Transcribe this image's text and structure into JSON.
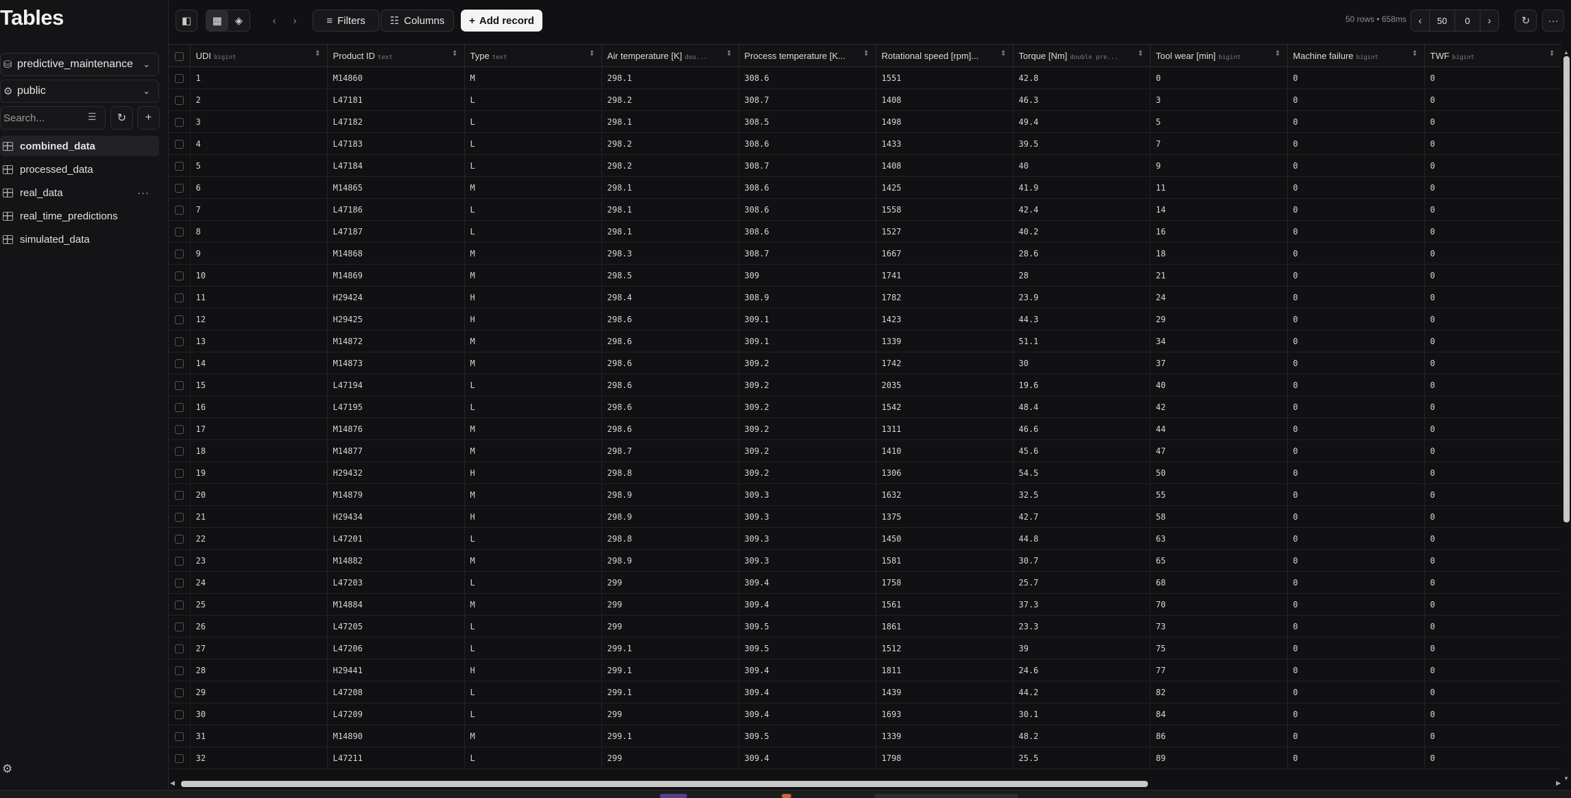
{
  "sidebar": {
    "title": "Tables",
    "database": "predictive_maintenance",
    "schema": "public",
    "search_placeholder": "Search...",
    "tables": [
      {
        "name": "combined_data"
      },
      {
        "name": "processed_data"
      },
      {
        "name": "real_data"
      },
      {
        "name": "real_time_predictions"
      },
      {
        "name": "simulated_data"
      }
    ],
    "more_glyph": "···",
    "settings_icon": "gear-icon"
  },
  "toolbar": {
    "filters_label": "Filters",
    "columns_label": "Columns",
    "add_record_label": "Add record",
    "stats": "50 rows • 658ms",
    "page_size": "50",
    "page_offset": "0"
  },
  "columns": [
    {
      "name": "UDI",
      "type": "bigint"
    },
    {
      "name": "Product ID",
      "type": "text"
    },
    {
      "name": "Type",
      "type": "text"
    },
    {
      "name": "Air temperature [K]",
      "type": "dou..."
    },
    {
      "name": "Process temperature [K...",
      "type": ""
    },
    {
      "name": "Rotational speed [rpm]...",
      "type": ""
    },
    {
      "name": "Torque [Nm]",
      "type": "double pre..."
    },
    {
      "name": "Tool wear [min]",
      "type": "bigint"
    },
    {
      "name": "Machine failure",
      "type": "bigint"
    },
    {
      "name": "TWF",
      "type": "bigint"
    }
  ],
  "rows": [
    [
      "1",
      "M14860",
      "M",
      "298.1",
      "308.6",
      "1551",
      "42.8",
      "0",
      "0",
      "0"
    ],
    [
      "2",
      "L47181",
      "L",
      "298.2",
      "308.7",
      "1408",
      "46.3",
      "3",
      "0",
      "0"
    ],
    [
      "3",
      "L47182",
      "L",
      "298.1",
      "308.5",
      "1498",
      "49.4",
      "5",
      "0",
      "0"
    ],
    [
      "4",
      "L47183",
      "L",
      "298.2",
      "308.6",
      "1433",
      "39.5",
      "7",
      "0",
      "0"
    ],
    [
      "5",
      "L47184",
      "L",
      "298.2",
      "308.7",
      "1408",
      "40",
      "9",
      "0",
      "0"
    ],
    [
      "6",
      "M14865",
      "M",
      "298.1",
      "308.6",
      "1425",
      "41.9",
      "11",
      "0",
      "0"
    ],
    [
      "7",
      "L47186",
      "L",
      "298.1",
      "308.6",
      "1558",
      "42.4",
      "14",
      "0",
      "0"
    ],
    [
      "8",
      "L47187",
      "L",
      "298.1",
      "308.6",
      "1527",
      "40.2",
      "16",
      "0",
      "0"
    ],
    [
      "9",
      "M14868",
      "M",
      "298.3",
      "308.7",
      "1667",
      "28.6",
      "18",
      "0",
      "0"
    ],
    [
      "10",
      "M14869",
      "M",
      "298.5",
      "309",
      "1741",
      "28",
      "21",
      "0",
      "0"
    ],
    [
      "11",
      "H29424",
      "H",
      "298.4",
      "308.9",
      "1782",
      "23.9",
      "24",
      "0",
      "0"
    ],
    [
      "12",
      "H29425",
      "H",
      "298.6",
      "309.1",
      "1423",
      "44.3",
      "29",
      "0",
      "0"
    ],
    [
      "13",
      "M14872",
      "M",
      "298.6",
      "309.1",
      "1339",
      "51.1",
      "34",
      "0",
      "0"
    ],
    [
      "14",
      "M14873",
      "M",
      "298.6",
      "309.2",
      "1742",
      "30",
      "37",
      "0",
      "0"
    ],
    [
      "15",
      "L47194",
      "L",
      "298.6",
      "309.2",
      "2035",
      "19.6",
      "40",
      "0",
      "0"
    ],
    [
      "16",
      "L47195",
      "L",
      "298.6",
      "309.2",
      "1542",
      "48.4",
      "42",
      "0",
      "0"
    ],
    [
      "17",
      "M14876",
      "M",
      "298.6",
      "309.2",
      "1311",
      "46.6",
      "44",
      "0",
      "0"
    ],
    [
      "18",
      "M14877",
      "M",
      "298.7",
      "309.2",
      "1410",
      "45.6",
      "47",
      "0",
      "0"
    ],
    [
      "19",
      "H29432",
      "H",
      "298.8",
      "309.2",
      "1306",
      "54.5",
      "50",
      "0",
      "0"
    ],
    [
      "20",
      "M14879",
      "M",
      "298.9",
      "309.3",
      "1632",
      "32.5",
      "55",
      "0",
      "0"
    ],
    [
      "21",
      "H29434",
      "H",
      "298.9",
      "309.3",
      "1375",
      "42.7",
      "58",
      "0",
      "0"
    ],
    [
      "22",
      "L47201",
      "L",
      "298.8",
      "309.3",
      "1450",
      "44.8",
      "63",
      "0",
      "0"
    ],
    [
      "23",
      "M14882",
      "M",
      "298.9",
      "309.3",
      "1581",
      "30.7",
      "65",
      "0",
      "0"
    ],
    [
      "24",
      "L47203",
      "L",
      "299",
      "309.4",
      "1758",
      "25.7",
      "68",
      "0",
      "0"
    ],
    [
      "25",
      "M14884",
      "M",
      "299",
      "309.4",
      "1561",
      "37.3",
      "70",
      "0",
      "0"
    ],
    [
      "26",
      "L47205",
      "L",
      "299",
      "309.5",
      "1861",
      "23.3",
      "73",
      "0",
      "0"
    ],
    [
      "27",
      "L47206",
      "L",
      "299.1",
      "309.5",
      "1512",
      "39",
      "75",
      "0",
      "0"
    ],
    [
      "28",
      "H29441",
      "H",
      "299.1",
      "309.4",
      "1811",
      "24.6",
      "77",
      "0",
      "0"
    ],
    [
      "29",
      "L47208",
      "L",
      "299.1",
      "309.4",
      "1439",
      "44.2",
      "82",
      "0",
      "0"
    ],
    [
      "30",
      "L47209",
      "L",
      "299",
      "309.4",
      "1693",
      "30.1",
      "84",
      "0",
      "0"
    ],
    [
      "31",
      "M14890",
      "M",
      "299.1",
      "309.5",
      "1339",
      "48.2",
      "86",
      "0",
      "0"
    ],
    [
      "32",
      "L47211",
      "L",
      "299",
      "309.4",
      "1798",
      "25.5",
      "89",
      "0",
      "0"
    ]
  ],
  "colors": {
    "background": "#111113",
    "sidebar": "#141416",
    "primary_button": "#f4f4f4",
    "border": "#2a2a2d"
  }
}
